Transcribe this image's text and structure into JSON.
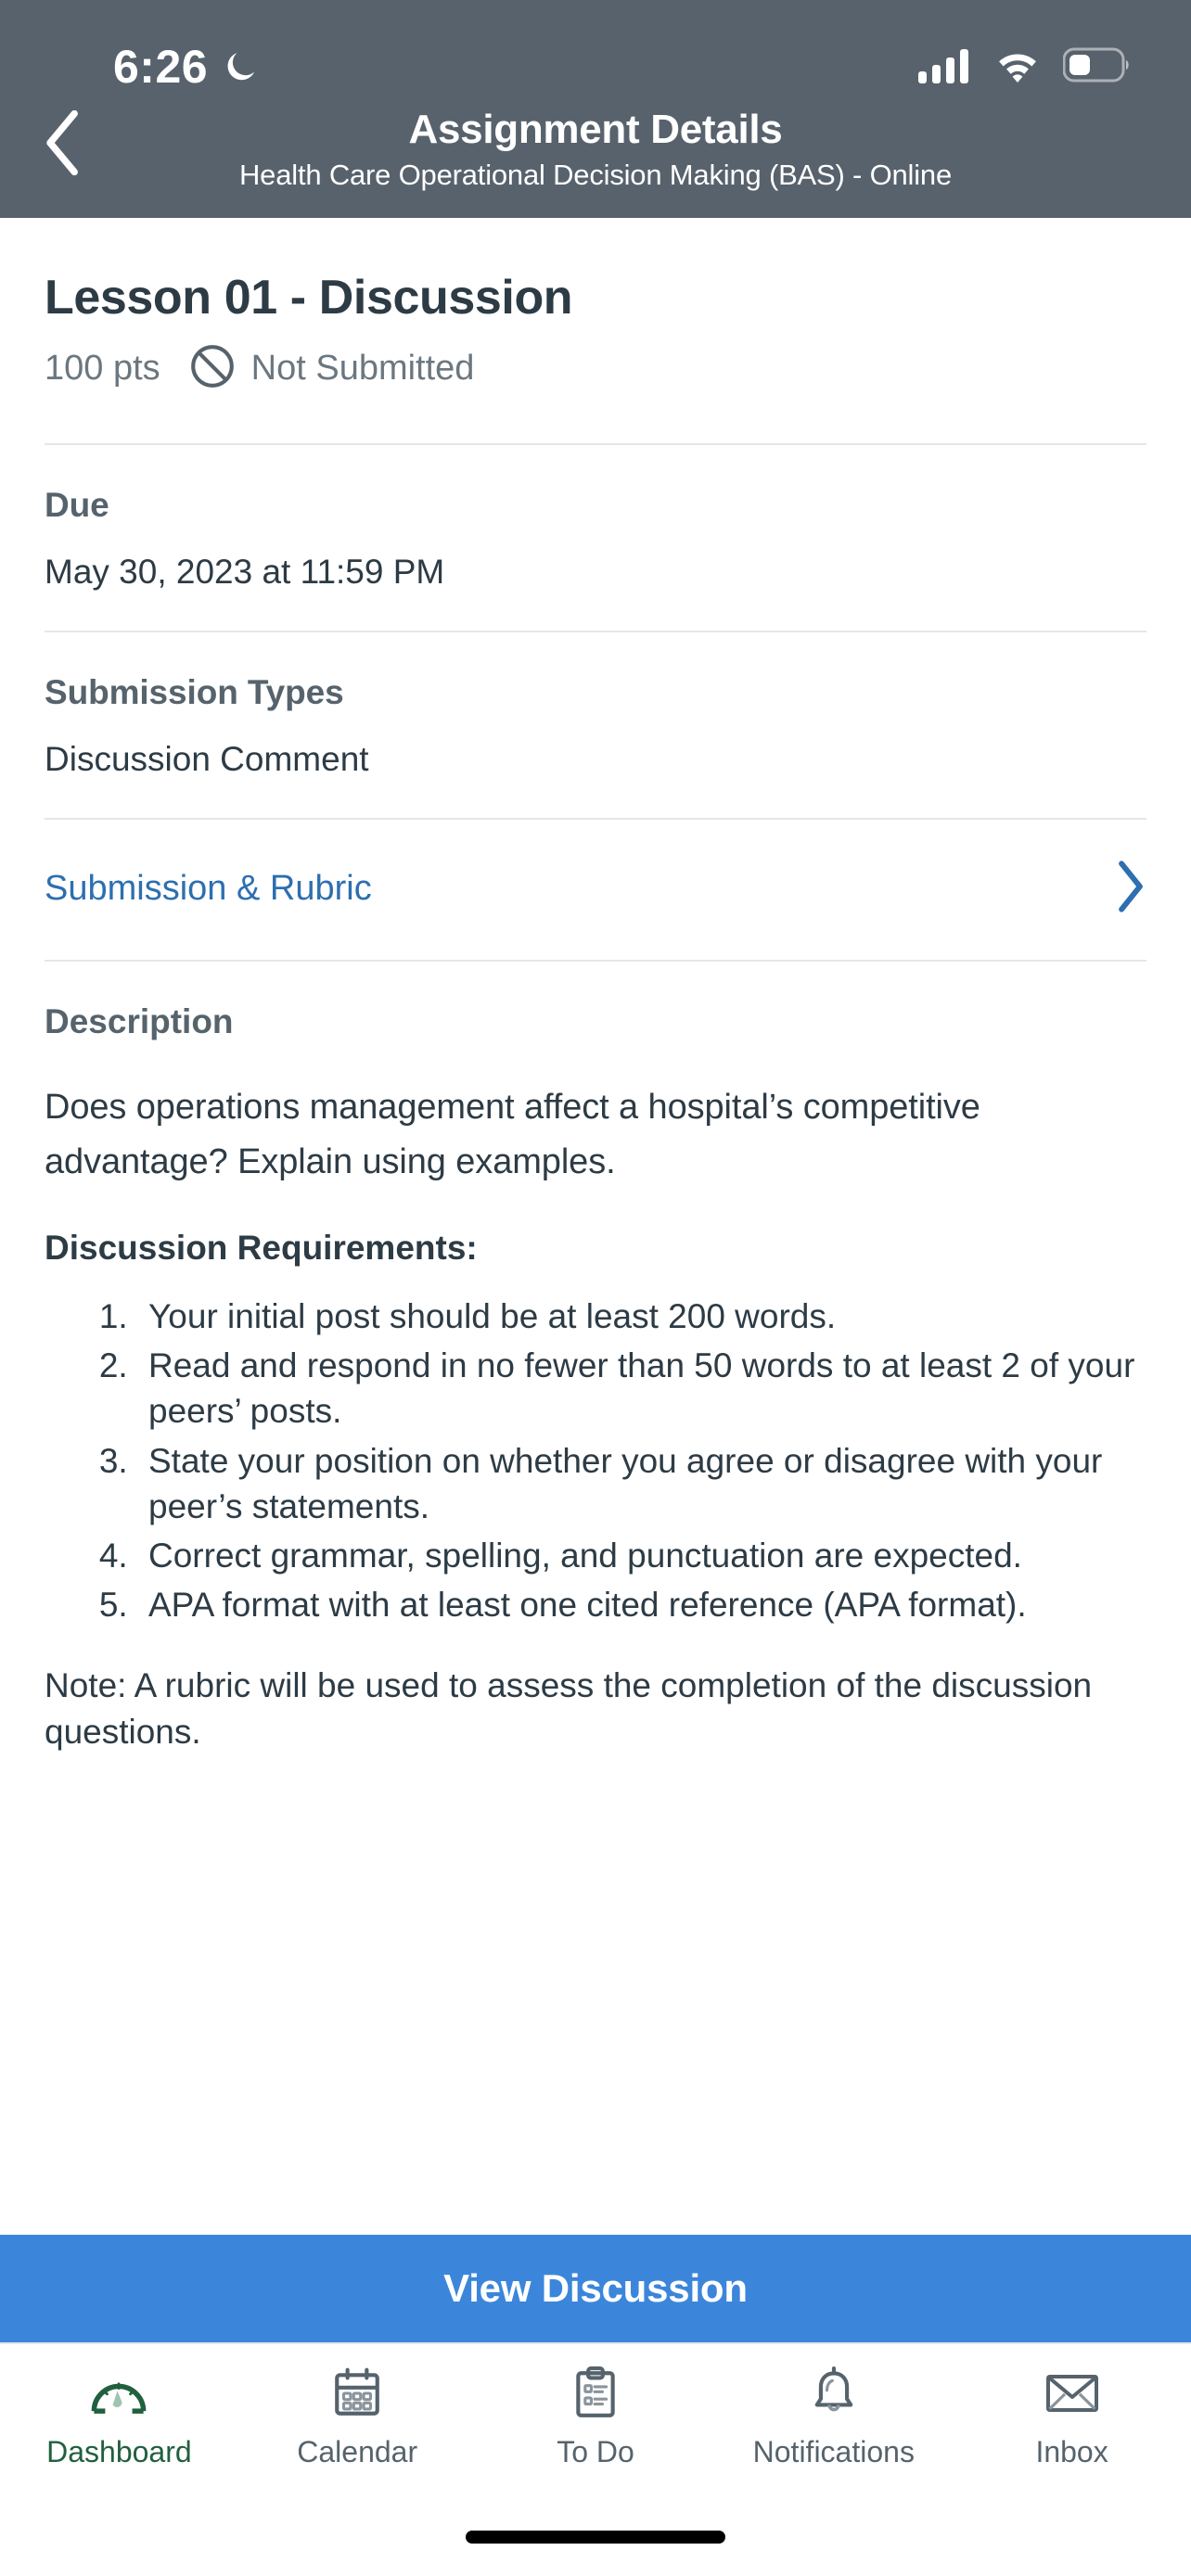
{
  "status_bar": {
    "time": "6:26",
    "dnd_icon": "moon-icon",
    "cellular_icon": "cellular-signal-icon",
    "wifi_icon": "wifi-icon",
    "battery_icon": "battery-icon"
  },
  "nav": {
    "back_icon": "chevron-left-icon",
    "title": "Assignment Details",
    "subtitle": "Health Care Operational Decision Making (BAS) - Online"
  },
  "assignment": {
    "title": "Lesson 01 - Discussion",
    "points": "100 pts",
    "status_icon": "no-entry-icon",
    "status": "Not Submitted"
  },
  "due": {
    "label": "Due",
    "value": "May 30, 2023 at 11:59 PM"
  },
  "submission_types": {
    "label": "Submission Types",
    "value": "Discussion Comment"
  },
  "submission_rubric": {
    "label": "Submission & Rubric",
    "chevron_icon": "chevron-right-icon"
  },
  "description": {
    "label": "Description",
    "paragraph": "Does operations management affect a hospital’s competitive advantage? Explain using examples.",
    "requirements_heading": "Discussion Requirements:",
    "requirements": [
      "Your initial post should be at least 200 words.",
      "Read and respond in no fewer than 50 words to at least 2 of your peers’ posts.",
      "State your position on whether you agree or disagree with your peer’s statements.",
      "Correct grammar, spelling, and punctuation are expected.",
      "APA format with at least one cited reference (APA format)."
    ],
    "note": "Note:  A rubric will be used to assess the completion of the discussion questions."
  },
  "action_button": {
    "label": "View Discussion"
  },
  "tabbar": {
    "items": [
      {
        "label": "Dashboard",
        "icon": "gauge-icon",
        "active": true
      },
      {
        "label": "Calendar",
        "icon": "calendar-icon",
        "active": false
      },
      {
        "label": "To Do",
        "icon": "clipboard-list-icon",
        "active": false
      },
      {
        "label": "Notifications",
        "icon": "bell-icon",
        "active": false
      },
      {
        "label": "Inbox",
        "icon": "envelope-icon",
        "active": false
      }
    ]
  },
  "colors": {
    "header_bg": "#58626D",
    "accent_blue": "#3B86DB",
    "link_blue": "#2D6FB0",
    "active_tab_green": "#20603F",
    "text_dark": "#2D3B45",
    "text_muted": "#6B7780"
  }
}
